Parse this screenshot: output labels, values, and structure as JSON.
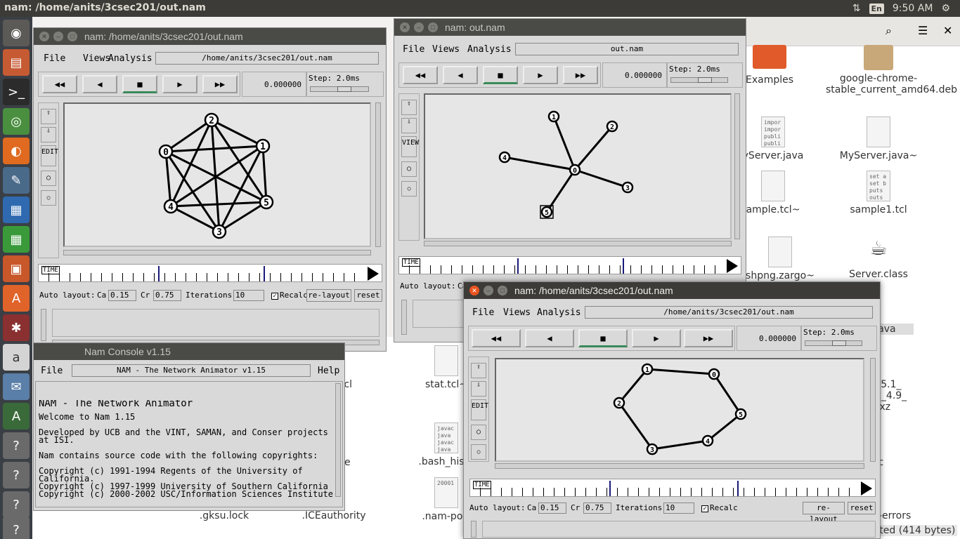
{
  "topbar": {
    "title": "nam: /home/anits/3csec201/out.nam",
    "lang": "En",
    "time": "9:50 AM"
  },
  "desktop": {
    "icons": [
      {
        "label": "Examples"
      },
      {
        "label": "google-chrome-stable_current_amd64.deb"
      },
      {
        "label": "yServer.java",
        "preview": "impor impor publi publi"
      },
      {
        "label": "MyServer.java~"
      },
      {
        "label": "ample.tcl~"
      },
      {
        "label": "sample1.tcl",
        "preview": "set a set b puts outs"
      },
      {
        "label": "shpng.zargo~"
      },
      {
        "label": "Server.class"
      },
      {
        "label": "t.java"
      },
      {
        "label": "stat.tcl~"
      },
      {
        "label": "_12.5.1_ inux_4.9_ .tar.xz"
      },
      {
        "label": ".bash_histo",
        "preview": "javac java javac java"
      },
      {
        "label": "rc"
      },
      {
        "label": ".gksu.lock"
      },
      {
        "label": ".ICEauthority"
      },
      {
        "label": ".nam-port",
        "preview": "20001"
      },
      {
        "label": "-errors"
      },
      {
        "label": "tcl"
      },
      {
        "label": "e"
      },
      {
        "label": "sted (414 bytes)"
      }
    ]
  },
  "win1": {
    "title": "nam: /home/anits/3csec201/out.nam",
    "menu": [
      "File",
      "Views",
      "Analysis"
    ],
    "path": "/home/anits/3csec201/out.nam",
    "time": "0.000000",
    "step": "Step: 2.0ms",
    "nodes": [
      "0",
      "1",
      "2",
      "3",
      "4",
      "5"
    ],
    "autolayout": {
      "label": "Auto layout:",
      "ca_label": "Ca",
      "ca": "0.15",
      "cr_label": "Cr",
      "cr": "0.75",
      "iter_label": "Iterations",
      "iter": "10",
      "recalc": "Recalc",
      "relayout": "re-layout",
      "reset": "reset"
    }
  },
  "win2": {
    "title": "nam: out.nam",
    "menu": [
      "File",
      "Views",
      "Analysis"
    ],
    "path": "out.nam",
    "time": "0.000000",
    "step": "Step: 2.0ms",
    "nodes": [
      "0",
      "1",
      "2",
      "3",
      "4",
      "5"
    ],
    "autolayout_label": "Auto layout:",
    "ca_label": "Ca"
  },
  "win3": {
    "title": "nam: /home/anits/3csec201/out.nam",
    "menu": [
      "File",
      "Views",
      "Analysis"
    ],
    "path": "/home/anits/3csec201/out.nam",
    "time": "0.000000",
    "step": "Step: 2.0ms",
    "nodes": [
      "0",
      "1",
      "2",
      "3",
      "4",
      "5"
    ],
    "autolayout": {
      "label": "Auto layout:",
      "ca_label": "Ca",
      "ca": "0.15",
      "cr_label": "Cr",
      "cr": "0.75",
      "iter_label": "Iterations",
      "iter": "10",
      "recalc": "Recalc",
      "relayout": "re-layout",
      "reset": "reset"
    }
  },
  "console": {
    "title": "Nam Console v1.15",
    "file_menu": "File",
    "header": "NAM - The Network Animator v1.15",
    "help": "Help",
    "lines": [
      "NAM - The Network Animator",
      "Welcome to Nam 1.15",
      "Developed by UCB and the VINT, SAMAN, and Conser projects at ISI.",
      "Nam contains source code with the following copyrights:",
      "Copyright (c) 1991-1994 Regents of the University of California.\nCopyright (c) 1997-1999 University of Southern California\nCopyright (c) 2000-2002 USC/Information Sciences Institute"
    ]
  },
  "shared": {
    "view_label": "VIEW",
    "edit_label": "EDIT",
    "time_label": "TIME"
  }
}
